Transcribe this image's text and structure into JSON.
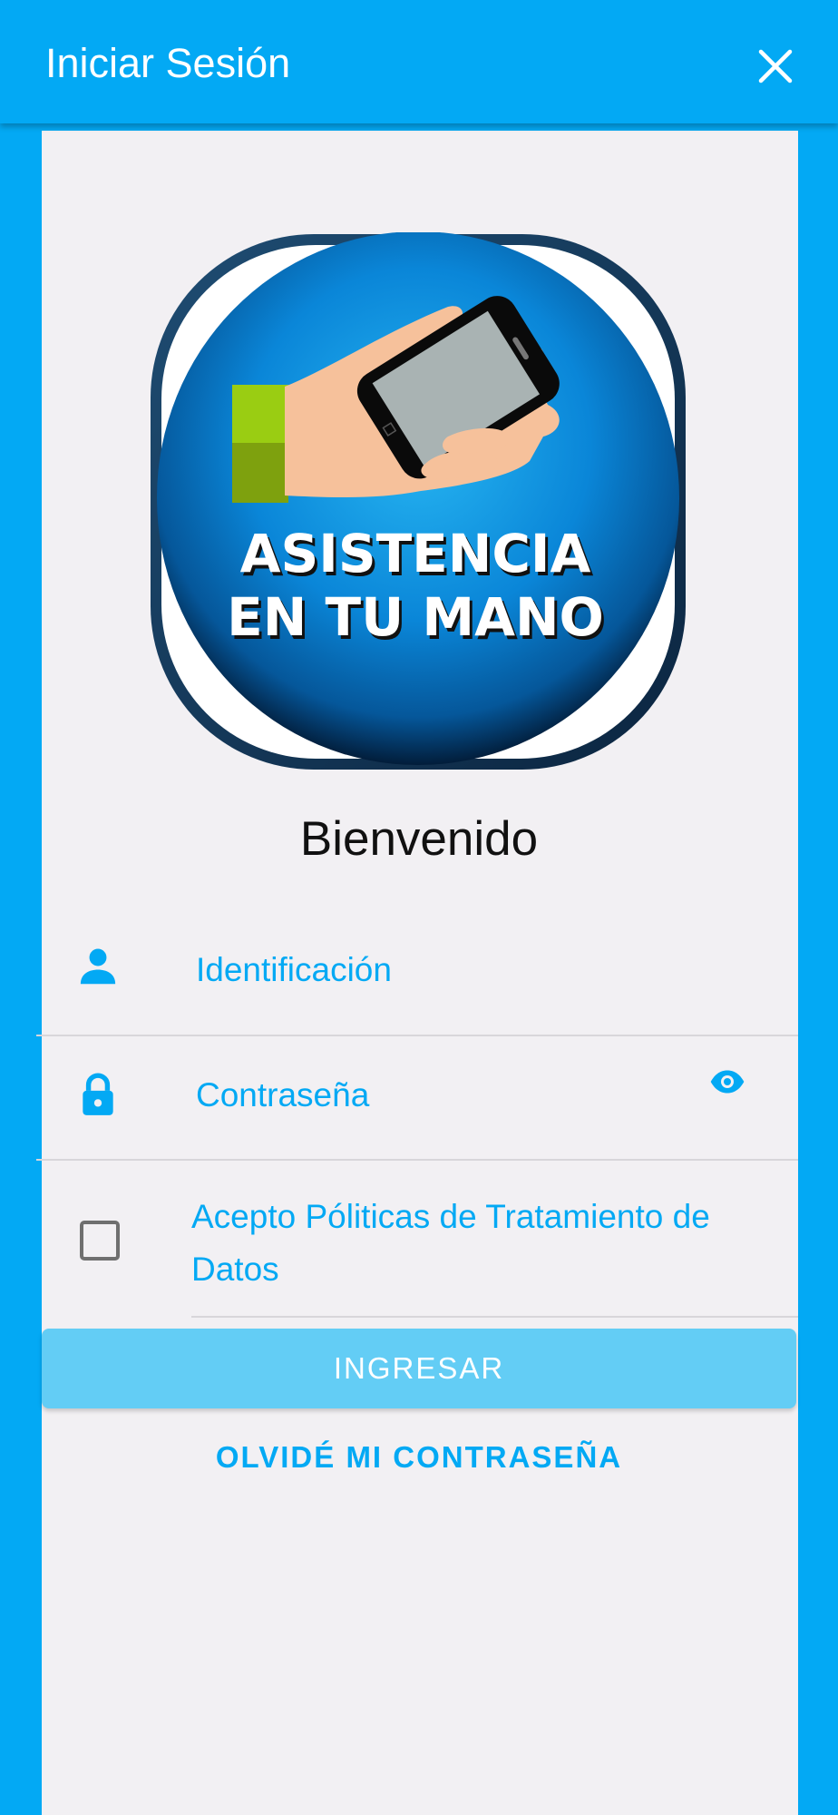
{
  "appbar": {
    "title": "Iniciar Sesión",
    "close_icon": "close-icon"
  },
  "logo": {
    "line1": "ASISTENCIA",
    "line2": "EN TU MANO"
  },
  "welcome": "Bienvenido",
  "form": {
    "id_placeholder": "Identificación",
    "id_icon": "person-icon",
    "password_placeholder": "Contraseña",
    "password_icon": "lock-icon",
    "visibility_icon": "eye-icon",
    "accept_label": "Acepto Póliticas de Tratamiento de Datos",
    "accept_checked": false
  },
  "buttons": {
    "login": "INGRESAR",
    "forgot": "OLVIDÉ MI CONTRASEÑA"
  },
  "colors": {
    "primary": "#03a9f4",
    "primary_light": "#63cdf5",
    "panel_bg": "#f2f0f3",
    "text_dark": "#111111"
  }
}
